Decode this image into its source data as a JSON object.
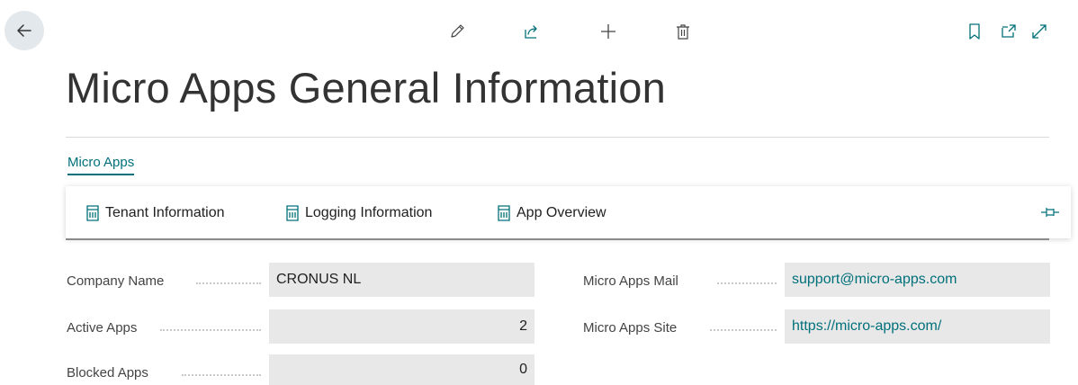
{
  "header": {
    "title": "Micro Apps General Information"
  },
  "tabs": [
    {
      "label": "Micro Apps"
    }
  ],
  "actions": [
    {
      "label": "Tenant Information"
    },
    {
      "label": "Logging Information"
    },
    {
      "label": "App Overview"
    }
  ],
  "fields": {
    "company_name": {
      "label": "Company Name",
      "value": "CRONUS NL"
    },
    "active_apps": {
      "label": "Active Apps",
      "value": "2"
    },
    "blocked_apps": {
      "label": "Blocked Apps",
      "value": "0"
    },
    "mail": {
      "label": "Micro Apps Mail",
      "value": "support@micro-apps.com"
    },
    "site": {
      "label": "Micro Apps Site",
      "value": "https://micro-apps.com/"
    }
  },
  "colors": {
    "accent": "#00707a",
    "field_bg": "#e8e8e8",
    "back_button_bg": "#e3e8ec"
  }
}
